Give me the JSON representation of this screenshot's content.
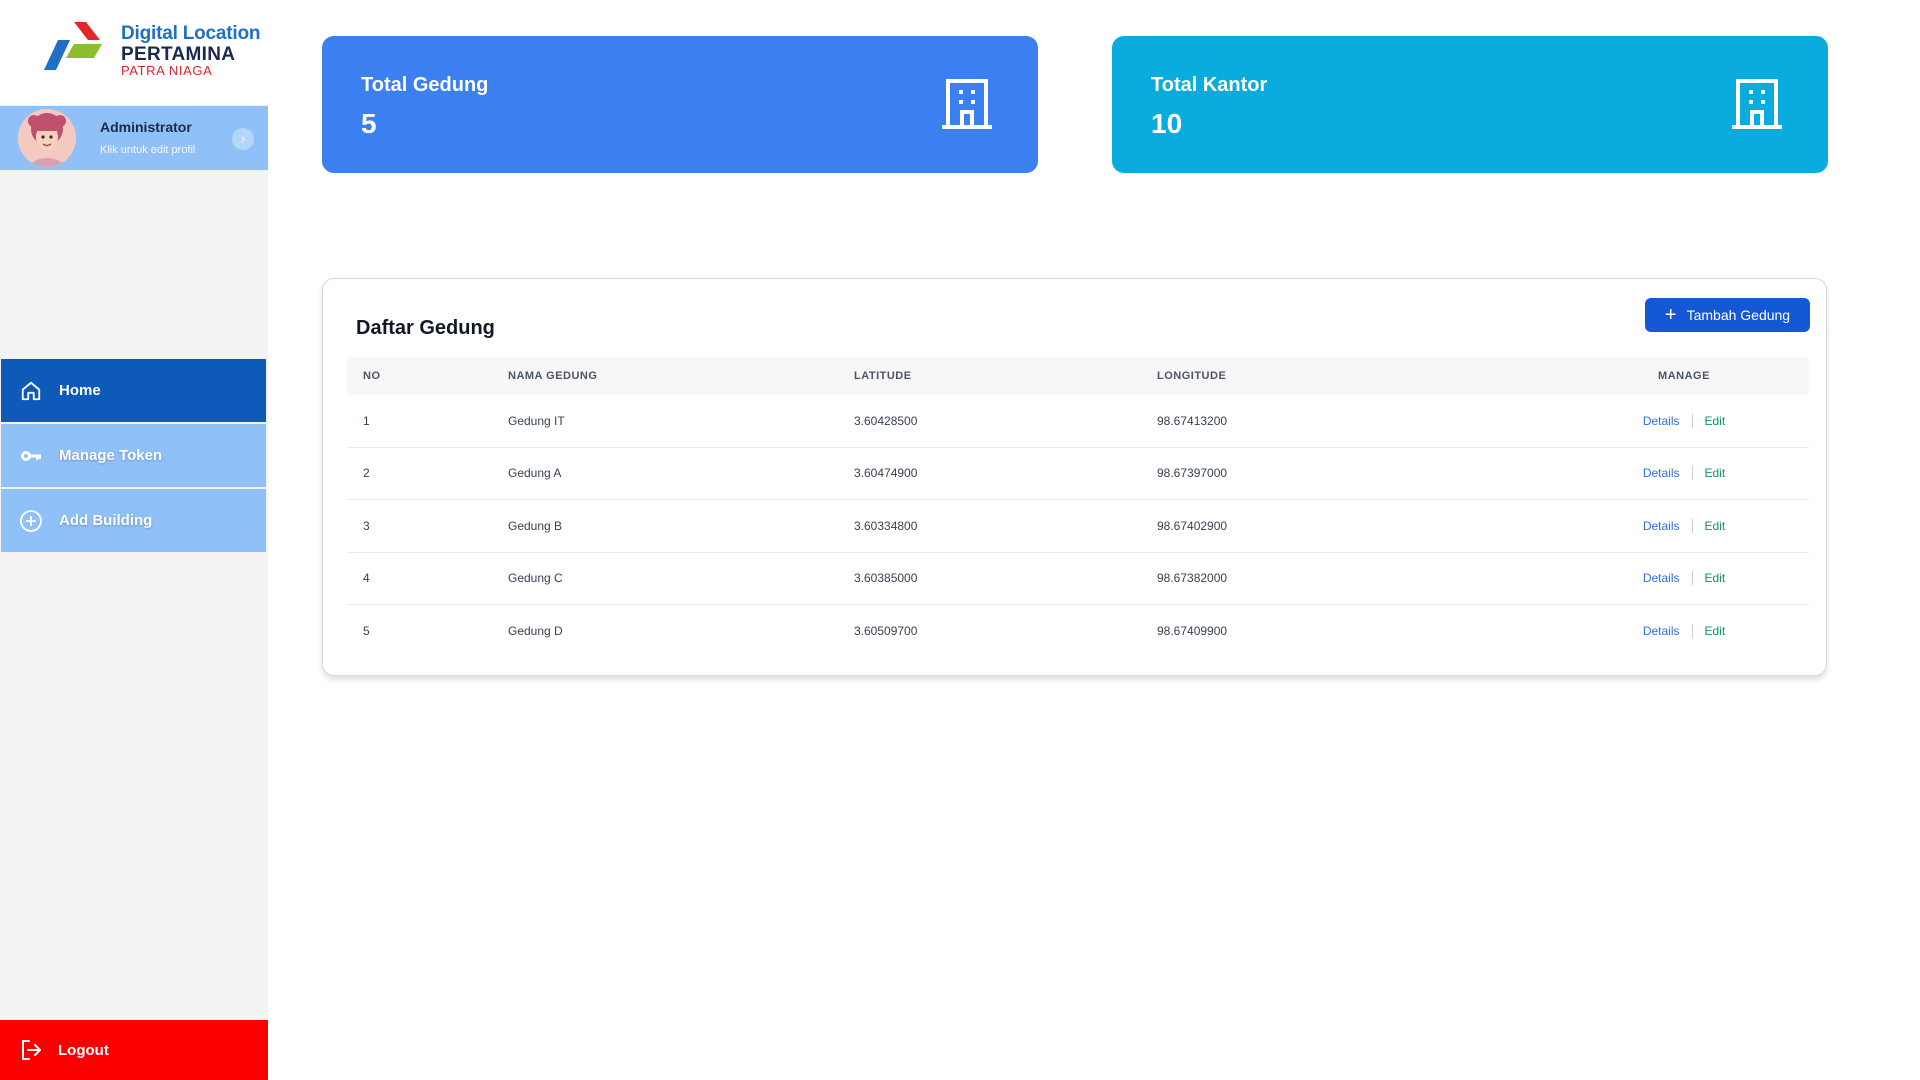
{
  "brand": {
    "line1": "Digital Location",
    "line2": "PERTAMINA",
    "line3": "PATRA NIAGA"
  },
  "profile": {
    "name": "Administrator",
    "subtitle": "Klik untuk edit profil",
    "chevron": "›"
  },
  "nav": {
    "items": [
      {
        "label": "Home",
        "icon": "home-icon",
        "active": true
      },
      {
        "label": "Manage Token",
        "icon": "key-icon",
        "active": false
      },
      {
        "label": "Add Building",
        "icon": "plus-circle-icon",
        "active": false
      }
    ],
    "logout": "Logout"
  },
  "cards": {
    "gedung": {
      "label": "Total Gedung",
      "value": "5",
      "icon": "building-icon"
    },
    "kantor": {
      "label": "Total Kantor",
      "value": "10",
      "icon": "building-icon"
    }
  },
  "table": {
    "title": "Daftar Gedung",
    "add_button": "Tambah Gedung",
    "columns": [
      "NO",
      "NAMA GEDUNG",
      "LATITUDE",
      "LONGITUDE",
      "MANAGE"
    ],
    "details_label": "Details",
    "edit_label": "Edit",
    "rows": [
      {
        "no": "1",
        "name": "Gedung IT",
        "lat": "3.60428500",
        "lon": "98.67413200"
      },
      {
        "no": "2",
        "name": "Gedung A",
        "lat": "3.60474900",
        "lon": "98.67397000"
      },
      {
        "no": "3",
        "name": "Gedung B",
        "lat": "3.60334800",
        "lon": "98.67402900"
      },
      {
        "no": "4",
        "name": "Gedung C",
        "lat": "3.60385000",
        "lon": "98.67382000"
      },
      {
        "no": "5",
        "name": "Gedung D",
        "lat": "3.60509700",
        "lon": "98.67409900"
      }
    ]
  },
  "colors": {
    "sidebar_active": "#0d5ab8",
    "sidebar_item": "#8fc1f8",
    "logout": "#fb0000",
    "card_gedung": "#3b7ff0",
    "card_kantor": "#0aacdd",
    "primary_button": "#1558d6"
  }
}
